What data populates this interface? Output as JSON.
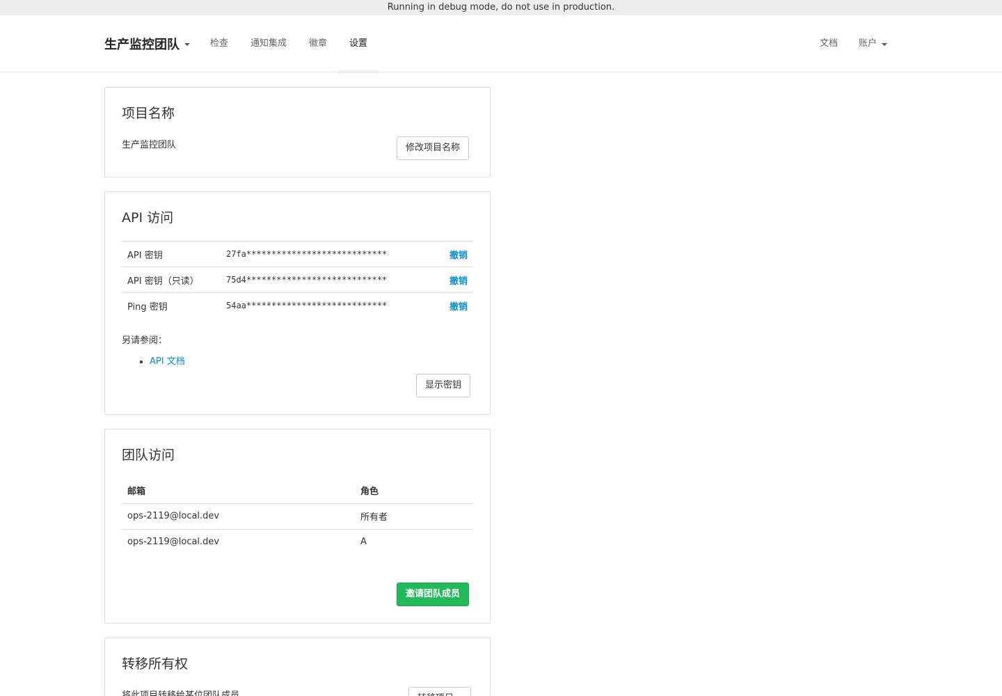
{
  "debug_banner": "Running in debug mode, do not use in production.",
  "navbar": {
    "brand": "生产监控团队",
    "nav_items": [
      "检查",
      "通知集成",
      "徽章",
      "设置"
    ],
    "active_item": "设置",
    "docs": "文档",
    "account": "账户"
  },
  "project_name_panel": {
    "title": "项目名称",
    "value": "生产监控团队",
    "button": "修改项目名称"
  },
  "api_panel": {
    "title": "API 访问",
    "keys": [
      {
        "label": "API 密钥",
        "value": "27fa****************************",
        "action": "撤销"
      },
      {
        "label": "API 密钥（只读）",
        "value": "75d4****************************",
        "action": "撤销"
      },
      {
        "label": "Ping 密钥",
        "value": "54aa****************************",
        "action": "撤销"
      }
    ],
    "see_also": "另请参阅：",
    "see_also_link": "API 文档",
    "show_keys_button": "显示密钥"
  },
  "team_panel": {
    "title": "团队访问",
    "columns": [
      "邮箱",
      "角色"
    ],
    "rows": [
      {
        "email": "ops-2119@local.dev",
        "role": "所有者"
      },
      {
        "email": "ops-2119@local.dev",
        "role": "A"
      }
    ],
    "invite_button": "邀请团队成员"
  },
  "transfer_panel": {
    "title": "转移所有权",
    "description": "将此项目转移给某位团队成员",
    "button": "转移项目..."
  },
  "colors": {
    "link": "#0a8fd3",
    "success": "#22b95a",
    "border": "#dddddd",
    "debug_bar": "#eeeeee"
  }
}
